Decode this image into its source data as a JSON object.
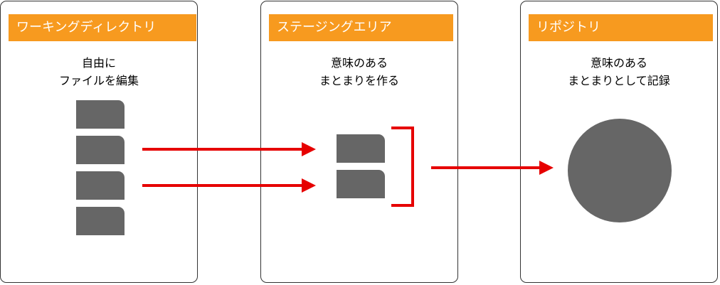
{
  "colors": {
    "header_bg": "#f79a1f",
    "file": "#666666",
    "arrow": "#e60000",
    "repository_circle": "#666666",
    "border": "#333333"
  },
  "panels": {
    "working": {
      "header": "ワーキングディレクトリ",
      "desc_line1": "自由に",
      "desc_line2": "ファイルを編集"
    },
    "staging": {
      "header": "ステージングエリア",
      "desc_line1": "意味のある",
      "desc_line2": "まとまりを作る"
    },
    "repository": {
      "header": "リポジトリ",
      "desc_line1": "意味のある",
      "desc_line2": "まとまりとして記録"
    }
  },
  "diagram": {
    "working_files": 4,
    "staged_files": 2,
    "flows": [
      {
        "from": "working-file-2",
        "to": "staged-file-1"
      },
      {
        "from": "working-file-3",
        "to": "staged-file-2"
      },
      {
        "from": "staging-group",
        "to": "repository"
      }
    ]
  }
}
